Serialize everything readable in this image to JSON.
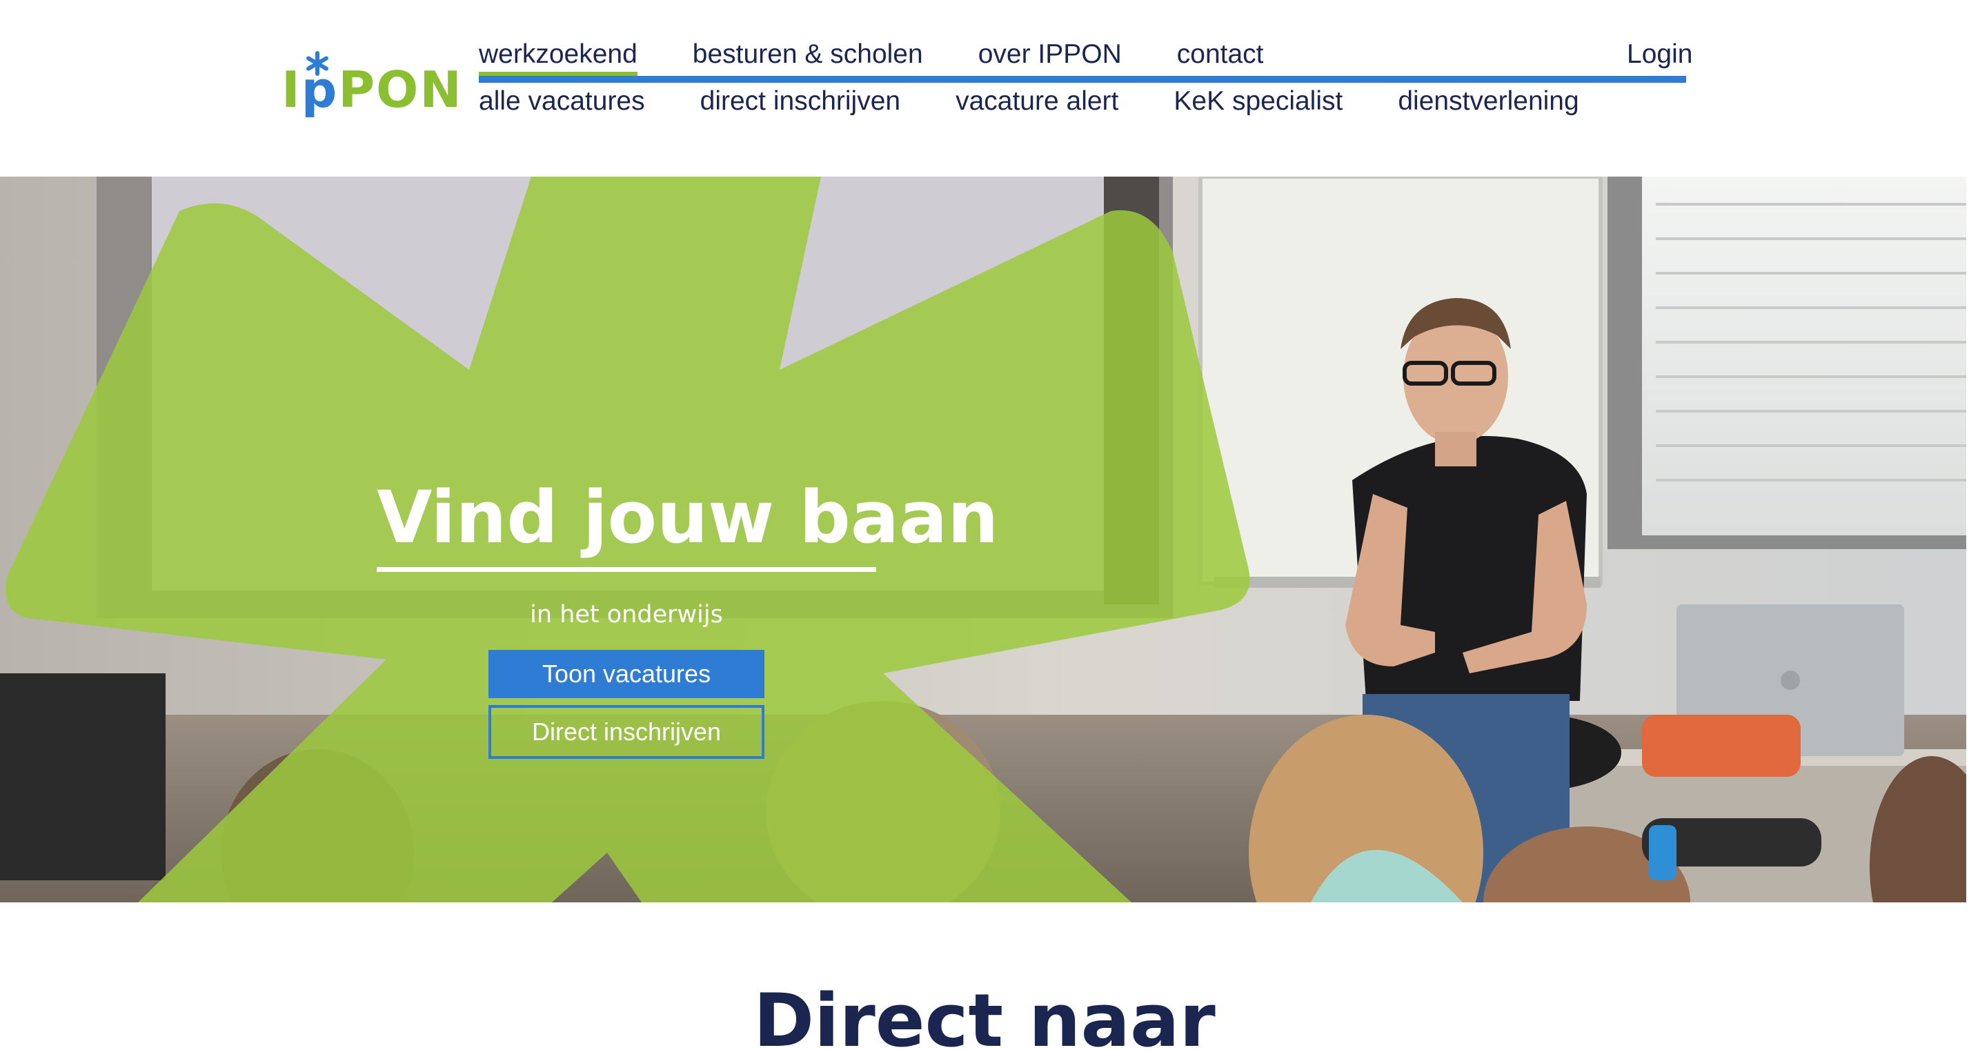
{
  "brand": {
    "logo_text": "IPPON",
    "colors": {
      "green": "#8cbf2f",
      "blue": "#2f7cd4",
      "navy": "#1a2650"
    }
  },
  "nav": {
    "main": [
      {
        "label": "werkzoekend",
        "active": true
      },
      {
        "label": "besturen & scholen",
        "active": false
      },
      {
        "label": "over IPPON",
        "active": false
      },
      {
        "label": "contact",
        "active": false
      }
    ],
    "login_label": "Login",
    "sub": [
      {
        "label": "alle vacatures"
      },
      {
        "label": "direct inschrijven"
      },
      {
        "label": "vacature alert"
      },
      {
        "label": "KeK specialist"
      },
      {
        "label": "dienstverlening"
      }
    ]
  },
  "hero": {
    "title": "Vind jouw baan",
    "subtitle": "in het onderwijs",
    "primary_button": "Toon vacatures",
    "secondary_button": "Direct inschrijven",
    "image_subject": "teacher presenting in classroom"
  },
  "section": {
    "heading": "Direct naar"
  }
}
